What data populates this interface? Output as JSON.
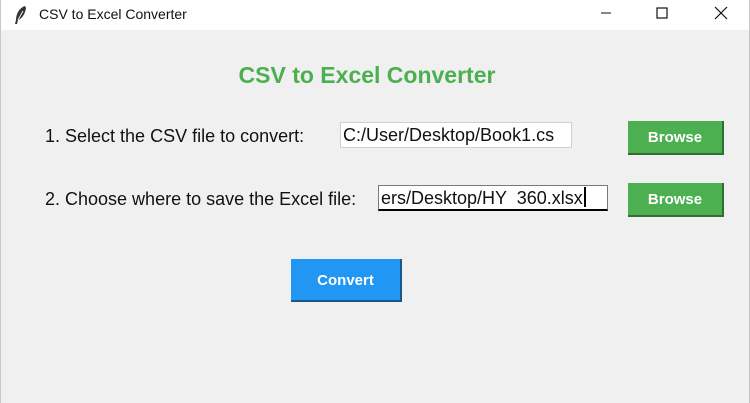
{
  "window": {
    "title": "CSV to Excel Converter",
    "app_icon": "feather-icon",
    "controls": {
      "minimize_icon": "minimize-icon",
      "maximize_icon": "maximize-icon",
      "close_icon": "close-icon"
    }
  },
  "main": {
    "heading": "CSV to Excel Converter",
    "heading_color": "#4caf50",
    "csv_row": {
      "label": "1. Select the CSV file to convert:",
      "value": "C:/User/Desktop/Book1.cs",
      "browse_label": "Browse"
    },
    "save_row": {
      "label": "2. Choose where to save the Excel file:",
      "value": "ers/Desktop/HY  360.xlsx",
      "browse_label": "Browse"
    },
    "convert_label": "Convert",
    "browse_color": "#4caf50",
    "convert_color": "#2196f3"
  }
}
